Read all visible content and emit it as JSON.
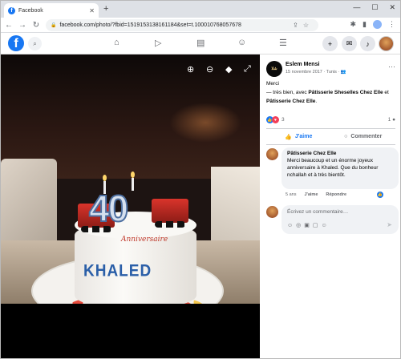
{
  "browser": {
    "tab_title": "Facebook",
    "new_tab": "+",
    "url": "facebook.com/photo/?fbid=1519153138161184&set=t.100010768057678"
  },
  "fb_header": {
    "logo": "f",
    "nav_icons": [
      "home-icon",
      "watch-icon",
      "marketplace-icon",
      "groups-icon",
      "menu-icon"
    ],
    "right_icons": [
      "create-icon",
      "messenger-icon",
      "notifications-icon"
    ]
  },
  "photo": {
    "cake_number": "40",
    "cake_name": "KHALED",
    "cake_script": "Anniversaire"
  },
  "post": {
    "author": "Eslem Mensi",
    "date": "15 novembre 2017",
    "location": "Tunis",
    "text_line1": "Merci",
    "text_prefix": "— très bien, avec ",
    "tag1": "Pâtisserie Sheselles Chez Elle",
    "text_mid": " et ",
    "tag2": "Pâtisserie Chez Elle",
    "text_end": ".",
    "reaction_count": "3",
    "comment_count": "1",
    "like_label": "J'aime",
    "comment_label": "Commenter"
  },
  "comment": {
    "author": "Pâtisserie Chez Elle",
    "text": "Merci beaucoup et un énorme joyeux anniversaire à Khaled. Que du bonheur nchallah et à très bientôt.",
    "age": "5 ans",
    "like": "J'aime",
    "reply": "Répondre"
  },
  "comment_input": {
    "placeholder": "Écrivez un commentaire…"
  }
}
